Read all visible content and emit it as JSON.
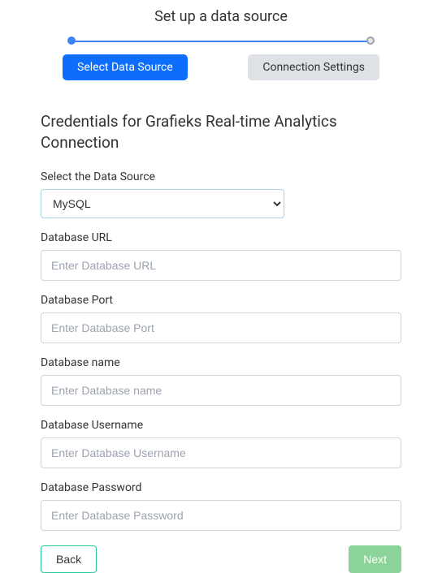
{
  "page_title": "Set up a data source",
  "steps": {
    "select_label": "Select Data Source",
    "connection_label": "Connection Settings"
  },
  "section_title": "Credentials for Grafieks Real-time Analytics Connection",
  "form": {
    "datasource_label": "Select the Data Source",
    "datasource_value": "MySQL",
    "url_label": "Database URL",
    "url_placeholder": "Enter Database URL",
    "port_label": "Database Port",
    "port_placeholder": "Enter Database Port",
    "name_label": "Database name",
    "name_placeholder": "Enter Database name",
    "username_label": "Database Username",
    "username_placeholder": "Enter Database Username",
    "password_label": "Database Password",
    "password_placeholder": "Enter Database Password"
  },
  "buttons": {
    "back": "Back",
    "next": "Next"
  }
}
